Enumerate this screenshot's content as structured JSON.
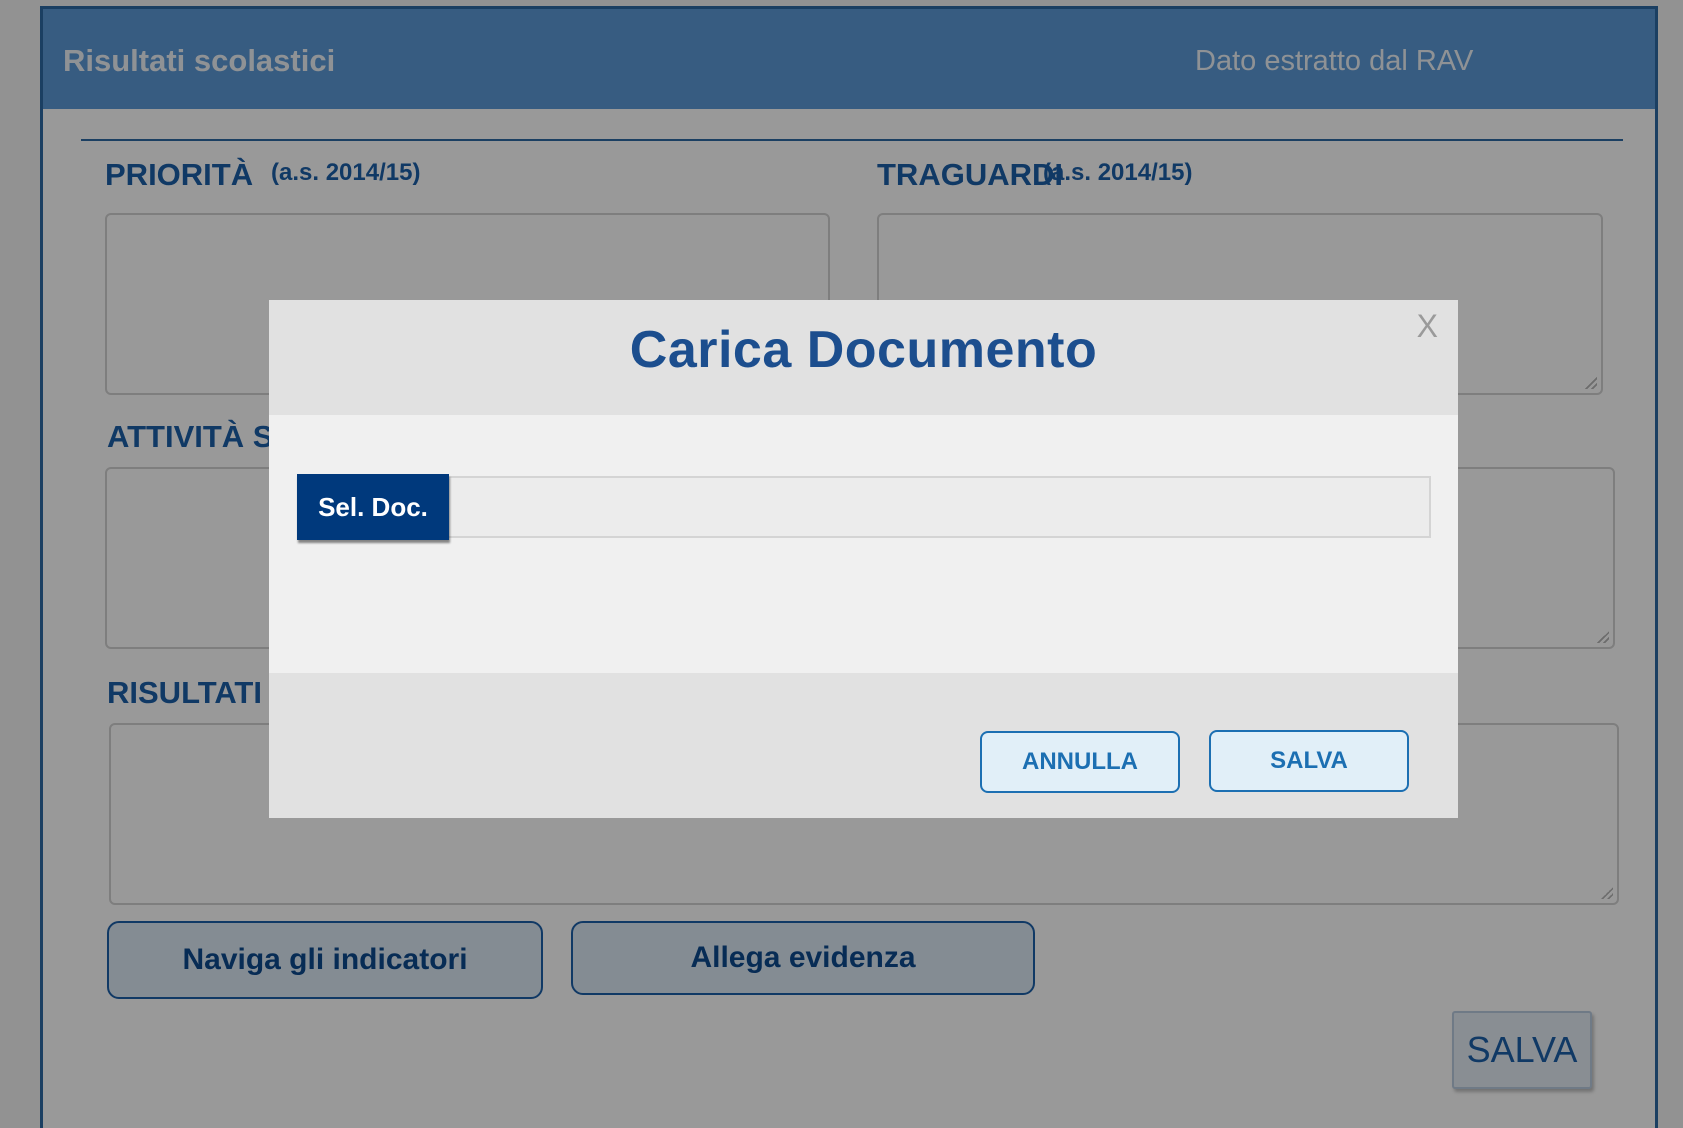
{
  "panel": {
    "title": "Risultati scolastici",
    "source": "Dato estratto dal RAV"
  },
  "sections": {
    "priorita": {
      "label": "PRIORITÀ",
      "year": "(a.s. 2014/15)"
    },
    "traguardi": {
      "label": "TRAGUARDI",
      "year": "(a.s. 2014/15)"
    },
    "attivita": {
      "label": "ATTIVITÀ SV"
    },
    "risultati": {
      "label": "RISULTATI"
    }
  },
  "buttons": {
    "naviga": "Naviga gli indicatori",
    "allega": "Allega evidenza",
    "salva": "SALVA"
  },
  "modal": {
    "title": "Carica Documento",
    "close": "X",
    "select_label": "Sel. Doc.",
    "cancel": "ANNULLA",
    "save": "SALVA"
  },
  "colors": {
    "header_bg": "#5d9ad7",
    "accent": "#1c5fa8",
    "select_button": "#00397c",
    "overlay": "rgba(0,0,0,0.40)"
  }
}
